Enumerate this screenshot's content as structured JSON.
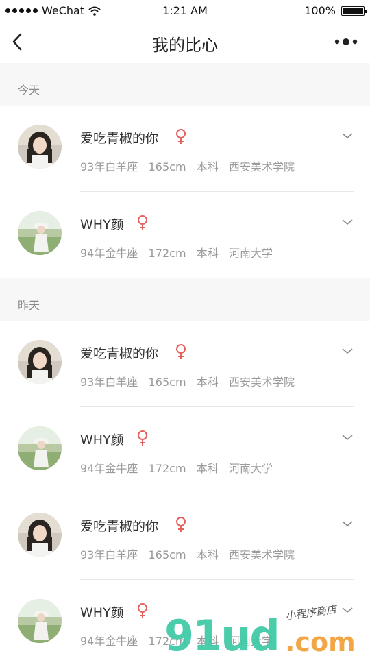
{
  "status_bar": {
    "carrier": "WeChat",
    "time": "1:21 AM",
    "battery": "100%",
    "battery_level": 1.0
  },
  "navbar": {
    "title": "我的比心",
    "back_icon": "chevron-left-icon",
    "more_icon": "more-dots-icon"
  },
  "sections": [
    {
      "label": "今天",
      "items": [
        {
          "name": "爱吃青椒的你",
          "meta": "93年白羊座   165cm   本科   西安美术学院",
          "gender": "female"
        },
        {
          "name": "WHY颜",
          "meta": "94年金牛座   172cm   本科   河南大学",
          "gender": "female"
        }
      ]
    },
    {
      "label": "昨天",
      "items": [
        {
          "name": "爱吃青椒的你",
          "meta": "93年白羊座   165cm   本科   西安美术学院",
          "gender": "female"
        },
        {
          "name": "WHY颜",
          "meta": "94年金牛座   172cm   本科   河南大学",
          "gender": "female"
        },
        {
          "name": "爱吃青椒的你",
          "meta": "93年白羊座   165cm   本科   西安美术学院",
          "gender": "female"
        },
        {
          "name": "WHY颜",
          "meta": "94年金牛座   172cm   本科   河南大学",
          "gender": "female"
        }
      ]
    }
  ],
  "watermark": {
    "main": "91ud",
    "suffix": ".com",
    "tagline": "小程序商店"
  },
  "colors": {
    "gender_icon": "#e5615d",
    "section_bg": "#f7f7f7",
    "watermark_green": "#3cc9a6",
    "watermark_orange": "#f2a23c"
  }
}
